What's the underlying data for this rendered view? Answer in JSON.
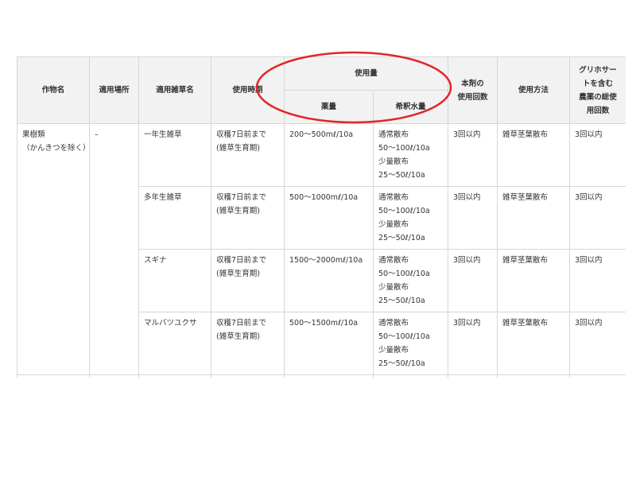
{
  "table": {
    "headers": {
      "crop": "作物名",
      "place": "適用場所",
      "weed": "適用雑草名",
      "timing": "使用時期",
      "amount_group": "使用量",
      "chemical": "薬量",
      "water": "希釈水量",
      "count_lines": [
        "本剤の",
        "使用回数"
      ],
      "method": "使用方法",
      "total_lines": [
        "グリホサー",
        "トを含む",
        "農薬の総使",
        "用回数"
      ]
    },
    "crop_lines": [
      "果樹類",
      "（かんきつを除く）"
    ],
    "place": "–",
    "rows": [
      {
        "weed": "一年生雑草",
        "timing_lines": [
          "収穫7日前まで",
          "(雑草生育期)"
        ],
        "chemical": "200～500mℓ/10a",
        "water_lines": [
          "通常散布",
          "50～100ℓ/10a",
          "少量散布",
          "25～50ℓ/10a"
        ],
        "count": "3回以内",
        "method": "雑草茎葉散布",
        "total": "3回以内"
      },
      {
        "weed": "多年生雑草",
        "timing_lines": [
          "収穫7日前まで",
          "(雑草生育期)"
        ],
        "chemical": "500～1000mℓ/10a",
        "water_lines": [
          "通常散布",
          "50～100ℓ/10a",
          "少量散布",
          "25～50ℓ/10a"
        ],
        "count": "3回以内",
        "method": "雑草茎葉散布",
        "total": "3回以内"
      },
      {
        "weed": "スギナ",
        "timing_lines": [
          "収穫7日前まで",
          "(雑草生育期)"
        ],
        "chemical": "1500～2000mℓ/10a",
        "water_lines": [
          "通常散布",
          "50～100ℓ/10a",
          "少量散布",
          "25～50ℓ/10a"
        ],
        "count": "3回以内",
        "method": "雑草茎葉散布",
        "total": "3回以内"
      },
      {
        "weed": "マルバツユクサ",
        "timing_lines": [
          "収穫7日前まで",
          "(雑草生育期)"
        ],
        "chemical": "500～1500mℓ/10a",
        "water_lines": [
          "通常散布",
          "50～100ℓ/10a",
          "少量散布",
          "25～50ℓ/10a"
        ],
        "count": "3回以内",
        "method": "雑草茎葉散布",
        "total": "3回以内"
      }
    ]
  },
  "annotation": {
    "shape": "ellipse",
    "color": "#e0262b"
  }
}
